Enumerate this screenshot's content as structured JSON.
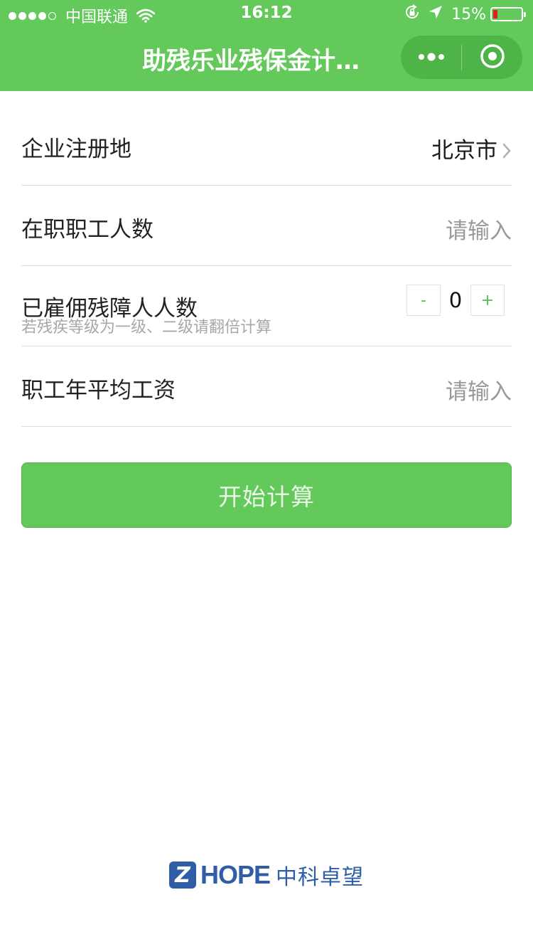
{
  "status_bar": {
    "carrier": "中国联通",
    "time": "16:12",
    "battery_percent": "15%",
    "battery_level": 0.15,
    "signal_dots_filled": 4,
    "icons": [
      "wifi-icon",
      "rotation-lock-icon",
      "location-arrow-icon",
      "battery-icon"
    ]
  },
  "nav": {
    "title": "助残乐业残保金计…",
    "more_icon": "more-dots-icon",
    "close_icon": "target-close-icon"
  },
  "form": {
    "location": {
      "label": "企业注册地",
      "value": "北京市"
    },
    "employees": {
      "label": "在职职工人数",
      "placeholder": "请输入"
    },
    "disabled": {
      "label": "已雇佣残障人人数",
      "hint": "若残疾等级为一级、二级请翻倍计算",
      "minus": "-",
      "value": "0",
      "plus": "+"
    },
    "salary": {
      "label": "职工年平均工资",
      "placeholder": "请输入"
    }
  },
  "actions": {
    "calculate_label": "开始计算"
  },
  "footer": {
    "logo_mark": "Z",
    "logo_en": "HOPE",
    "logo_cn": "中科卓望"
  },
  "colors": {
    "brand_green": "#63c95a",
    "capsule_green": "#4fb447",
    "logo_blue": "#2f5ea7",
    "battery_low": "#e02020"
  }
}
